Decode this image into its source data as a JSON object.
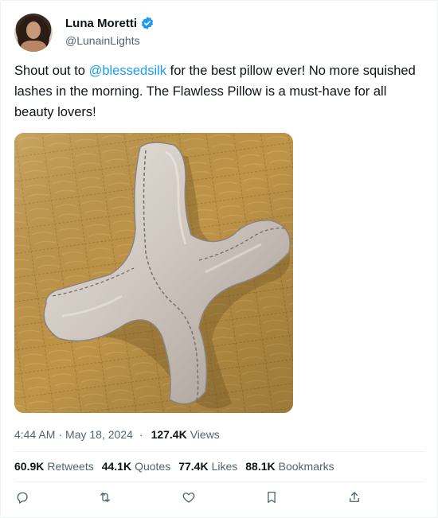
{
  "author": {
    "display_name": "Luna Moretti",
    "handle": "@LunainLights",
    "verified": true,
    "verified_icon": "verified-badge-icon",
    "verified_color": "#1d9bf0"
  },
  "tweet": {
    "text_before": "Shout out to ",
    "mention": "@blessedsilk",
    "text_after": " for the best pillow ever! No more squished lashes in the morning. The Flawless Pillow is a must-have for all beauty lovers!",
    "mention_color": "#1d9bf0"
  },
  "media": {
    "description_icon": "photo"
  },
  "meta": {
    "time": "4:44 AM",
    "dot1": "·",
    "date": "May 18, 2024",
    "dot2": "·",
    "views_count": "127.4K",
    "views_label": "Views"
  },
  "stats": [
    {
      "num": "60.9K",
      "label": "Retweets"
    },
    {
      "num": "44.1K",
      "label": "Quotes"
    },
    {
      "num": "77.4K",
      "label": "Likes"
    },
    {
      "num": "88.1K",
      "label": "Bookmarks"
    }
  ],
  "actions": [
    {
      "name": "reply",
      "icon": "reply-icon"
    },
    {
      "name": "retweet",
      "icon": "retweet-icon"
    },
    {
      "name": "like",
      "icon": "heart-icon"
    },
    {
      "name": "bookmark",
      "icon": "bookmark-icon"
    },
    {
      "name": "share",
      "icon": "share-icon"
    }
  ]
}
